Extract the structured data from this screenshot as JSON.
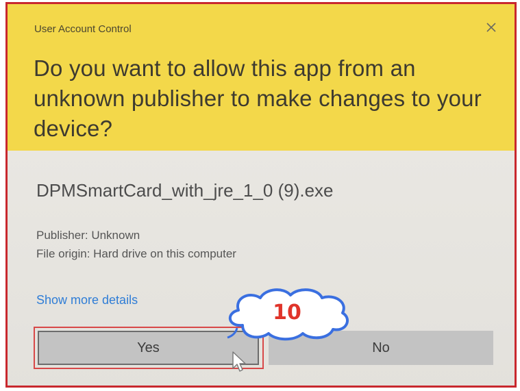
{
  "dialog": {
    "title": "User Account Control",
    "question": "Do you want to allow this app from an unknown publisher to make changes to your device?",
    "file_name": "DPMSmartCard_with_jre_1_0 (9).exe",
    "publisher": "Publisher: Unknown",
    "file_origin": "File origin: Hard drive on this computer",
    "details_link": "Show more details",
    "yes_label": "Yes",
    "no_label": "No"
  },
  "annotation": {
    "step_number": "10"
  },
  "colors": {
    "header": "#f3d84a",
    "body": "#e6e4df",
    "link": "#2f7dd6",
    "highlight": "#d84848",
    "callout_text": "#e0342a",
    "frame_border": "#c8282e"
  },
  "icons": {
    "close": "close-icon",
    "cursor": "mouse-pointer-icon",
    "callout": "cloud-callout"
  }
}
